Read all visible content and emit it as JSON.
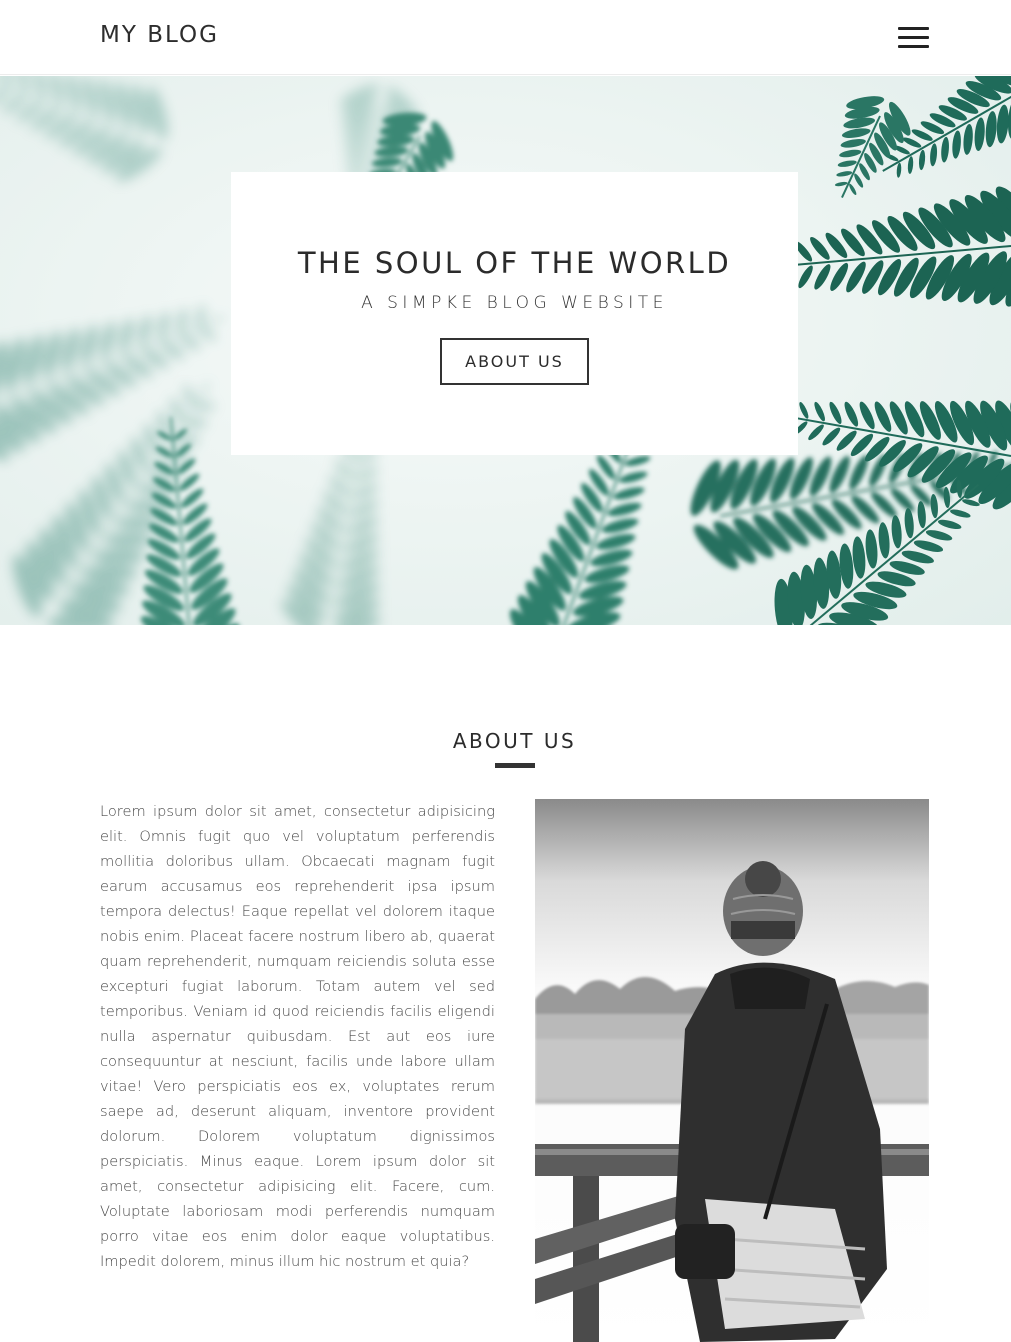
{
  "header": {
    "brand": "MY BLOG",
    "menu_icon": "hamburger-menu-icon"
  },
  "hero": {
    "background": "fern-leaves-photo",
    "title": "THE SOUL OF THE WORLD",
    "subtitle": "A SIMPKE BLOG WEBSITE",
    "button_label": "ABOUT US"
  },
  "about": {
    "heading": "ABOUT US",
    "paragraph": "Lorem ipsum dolor sit amet, consectetur adipisicing elit. Omnis fugit quo vel voluptatum perferendis mollitia doloribus ullam. Obcaecati magnam fugit earum accusamus eos reprehenderit ipsa ipsum tempora delectus! Eaque repellat vel dolorem itaque nobis enim. Placeat facere nostrum libero ab, quaerat quam reprehenderit, numquam reiciendis soluta esse excepturi fugiat laborum. Totam autem vel sed temporibus. Veniam id quod reiciendis facilis eligendi nulla aspernatur quibusdam. Est aut eos iure consequuntur at nesciunt, facilis unde labore ullam vitae! Vero perspiciatis eos ex, voluptates rerum saepe ad, deserunt aliquam, inventore provident dolorum. Dolorem voluptatum dignissimos perspiciatis. Minus eaque. Lorem ipsum dolor sit amet, consectetur adipisicing elit. Facere, cum. Voluptate laboriosam modi perferendis numquam porro vitae eos enim dolor eaque voluptatibus. Impedit dolorem, minus illum hic nostrum et quia?",
    "photo": "woman-at-railing-photo"
  },
  "colors": {
    "text_dark": "#2b2b2b",
    "fern_green": "#1f6b5a",
    "hero_bg": "#eef5f3"
  }
}
